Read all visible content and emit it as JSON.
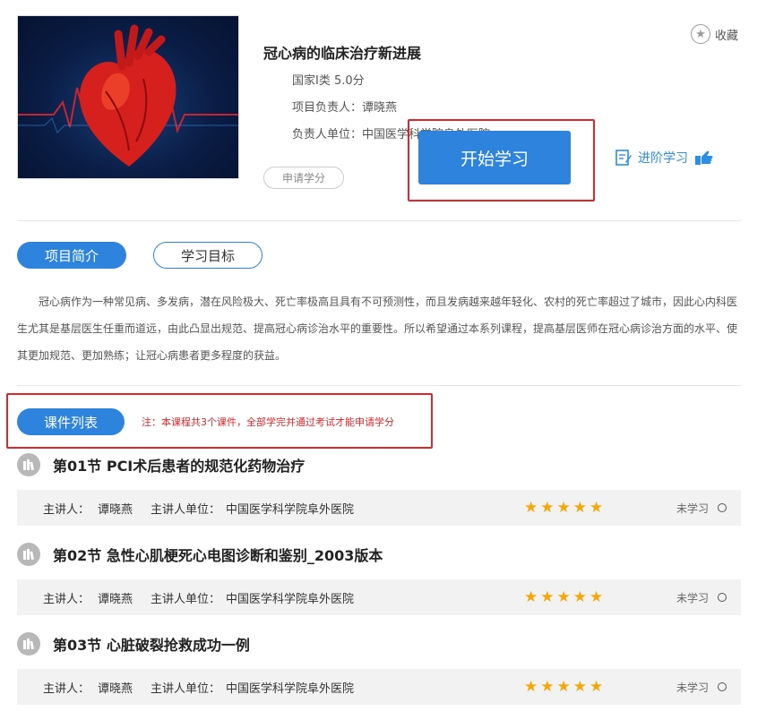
{
  "course": {
    "title": "冠心病的临床治疗新进展",
    "category": "国家I类 5.0分",
    "leader": "项目负责人：谭晓燕",
    "unit": "负责人单位：中国医学科学院阜外医院",
    "apply_credit_label": "申请学分",
    "start_label": "开始学习",
    "advanced_label": "进阶学习",
    "favorite_label": "收藏"
  },
  "tabs": [
    {
      "label": "项目简介",
      "active": true
    },
    {
      "label": "学习目标",
      "active": false
    }
  ],
  "intro": "冠心病作为一种常见病、多发病，潜在风险极大、死亡率极高且具有不可预测性，而且发病越来越年轻化、农村的死亡率超过了城市，因此心内科医生尤其是基层医生任重而道远，由此凸显出规范、提高冠心病诊治水平的重要性。所以希望通过本系列课程，提高基层医师在冠心病诊治方面的水平、使其更加规范、更加熟练；让冠心病患者更多程度的获益。",
  "course_list": {
    "label": "课件列表",
    "note": "注：本课程共3个课件，全部学完并通过考试才能申请学分"
  },
  "lessons": [
    {
      "title": "第01节 PCI术后患者的规范化药物治疗",
      "lecturer_label": "主讲人：",
      "lecturer": "谭晓燕",
      "unit_label": "主讲人单位：",
      "unit": "中国医学科学院阜外医院",
      "rating": 5,
      "status": "未学习"
    },
    {
      "title": "第02节 急性心肌梗死心电图诊断和鉴别_2003版本",
      "lecturer_label": "主讲人：",
      "lecturer": "谭晓燕",
      "unit_label": "主讲人单位：",
      "unit": "中国医学科学院阜外医院",
      "rating": 5,
      "status": "未学习"
    },
    {
      "title": "第03节 心脏破裂抢救成功一例",
      "lecturer_label": "主讲人：",
      "lecturer": "谭晓燕",
      "unit_label": "主讲人单位：",
      "unit": "中国医学科学院阜外医院",
      "rating": 5,
      "status": "未学习"
    }
  ],
  "colors": {
    "primary": "#2e84dd",
    "highlight_border": "#e0262a",
    "star": "#f5a70a",
    "link": "#2a8fe5"
  }
}
